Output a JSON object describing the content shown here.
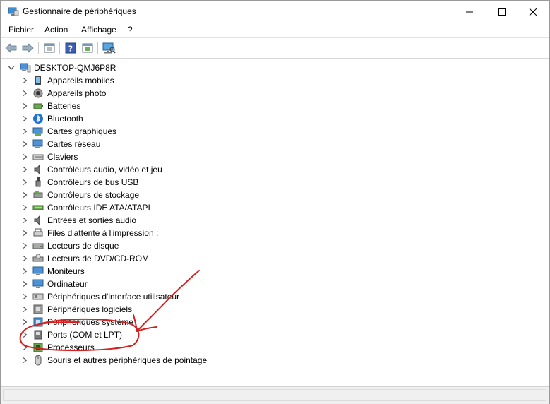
{
  "window": {
    "title": "Gestionnaire de périphériques",
    "icon": "device-manager-icon"
  },
  "menu": [
    "Fichier",
    "Action",
    "Affichage",
    "?"
  ],
  "toolbar": {
    "buttons": [
      "back-arrow-icon",
      "forward-arrow-icon",
      "properties-icon",
      "help-icon",
      "update-view-icon",
      "scan-hardware-icon"
    ]
  },
  "tree": {
    "root": "DESKTOP-QMJ6P8R",
    "nodes": [
      {
        "label": "Appareils mobiles",
        "icon": "mobile-device-icon"
      },
      {
        "label": "Appareils photo",
        "icon": "camera-icon"
      },
      {
        "label": "Batteries",
        "icon": "battery-icon"
      },
      {
        "label": "Bluetooth",
        "icon": "bluetooth-icon"
      },
      {
        "label": "Cartes graphiques",
        "icon": "display-adapter-icon"
      },
      {
        "label": "Cartes réseau",
        "icon": "network-adapter-icon"
      },
      {
        "label": "Claviers",
        "icon": "keyboard-icon"
      },
      {
        "label": "Contrôleurs audio, vidéo et jeu",
        "icon": "speaker-icon"
      },
      {
        "label": "Contrôleurs de bus USB",
        "icon": "usb-icon"
      },
      {
        "label": "Contrôleurs de stockage",
        "icon": "storage-controller-icon"
      },
      {
        "label": "Contrôleurs IDE ATA/ATAPI",
        "icon": "ide-controller-icon"
      },
      {
        "label": "Entrées et sorties audio",
        "icon": "audio-io-icon"
      },
      {
        "label": "Files d'attente à l'impression :",
        "icon": "printer-icon"
      },
      {
        "label": "Lecteurs de disque",
        "icon": "disk-drive-icon"
      },
      {
        "label": "Lecteurs de DVD/CD-ROM",
        "icon": "dvd-drive-icon"
      },
      {
        "label": "Moniteurs",
        "icon": "monitor-icon"
      },
      {
        "label": "Ordinateur",
        "icon": "computer-icon"
      },
      {
        "label": "Périphériques d'interface utilisateur",
        "icon": "hid-icon"
      },
      {
        "label": "Périphériques logiciels",
        "icon": "software-device-icon"
      },
      {
        "label": "Périphériques système",
        "icon": "system-device-icon"
      },
      {
        "label": "Ports (COM et LPT)",
        "icon": "port-icon"
      },
      {
        "label": "Processeurs",
        "icon": "processor-icon"
      },
      {
        "label": "Souris et autres périphériques de pointage",
        "icon": "mouse-icon"
      }
    ]
  },
  "annotation": {
    "color": "#d42020"
  }
}
